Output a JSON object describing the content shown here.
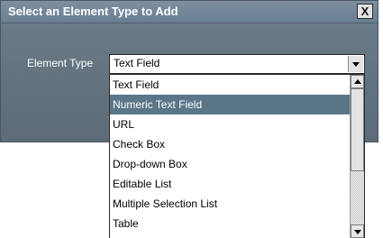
{
  "dialog": {
    "title": "Select an Element Type to Add",
    "close_label": "X"
  },
  "field": {
    "label": "Element Type",
    "selected_value": "Text Field"
  },
  "dropdown": {
    "options": [
      "Text Field",
      "Numeric Text Field",
      "URL",
      "Check Box",
      "Drop-down Box",
      "Editable List",
      "Multiple Selection List",
      "Table"
    ],
    "highlighted_index": 1
  },
  "colors": {
    "titlebar": "#6b7f92",
    "dialog_body": "#5e6e79",
    "highlight": "#5b7689"
  },
  "icons": {
    "close": "close-icon",
    "combo_arrow": "chevron-down-icon",
    "scroll_up": "arrow-up-icon",
    "scroll_down": "arrow-down-icon"
  }
}
